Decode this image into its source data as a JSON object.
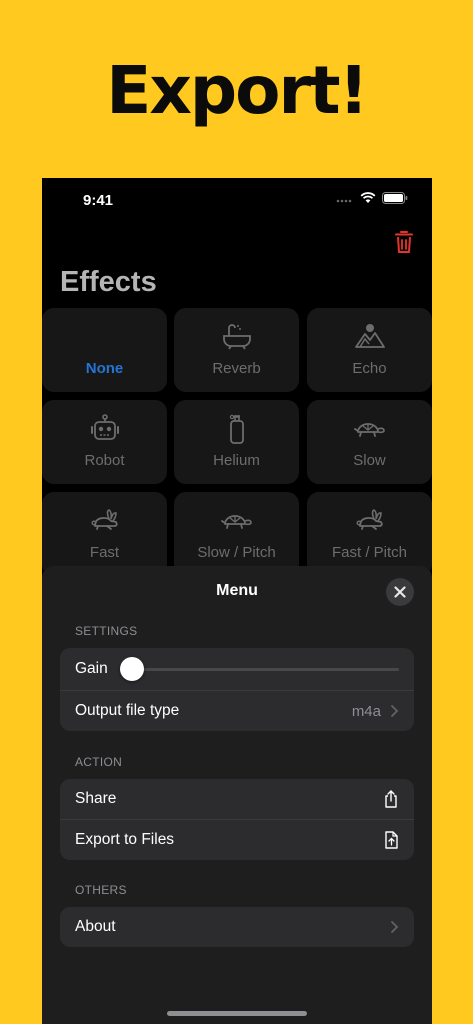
{
  "headline": "Export!",
  "status_bar": {
    "time": "9:41"
  },
  "effects": {
    "title": "Effects",
    "tiles": [
      {
        "label": "None",
        "icon": "none-icon"
      },
      {
        "label": "Reverb",
        "icon": "bathtub-icon"
      },
      {
        "label": "Echo",
        "icon": "mountain-icon"
      },
      {
        "label": "Robot",
        "icon": "robot-icon"
      },
      {
        "label": "Helium",
        "icon": "helium-tank-icon"
      },
      {
        "label": "Slow",
        "icon": "turtle-icon"
      },
      {
        "label": "Fast",
        "icon": "rabbit-icon"
      },
      {
        "label": "Slow / Pitch",
        "icon": "turtle-icon"
      },
      {
        "label": "Fast / Pitch",
        "icon": "rabbit-icon"
      }
    ],
    "selected": "None"
  },
  "menu": {
    "title": "Menu",
    "settings": {
      "header": "SETTINGS",
      "gain_label": "Gain",
      "gain_value": 0.0,
      "output_label": "Output file type",
      "output_value": "m4a"
    },
    "action": {
      "header": "ACTION",
      "share_label": "Share",
      "export_label": "Export to Files"
    },
    "others": {
      "header": "OTHERS",
      "about_label": "About"
    }
  },
  "colors": {
    "background": "#FFC91F",
    "accent_blue": "#2474D4",
    "trash_red": "#E5342B"
  }
}
